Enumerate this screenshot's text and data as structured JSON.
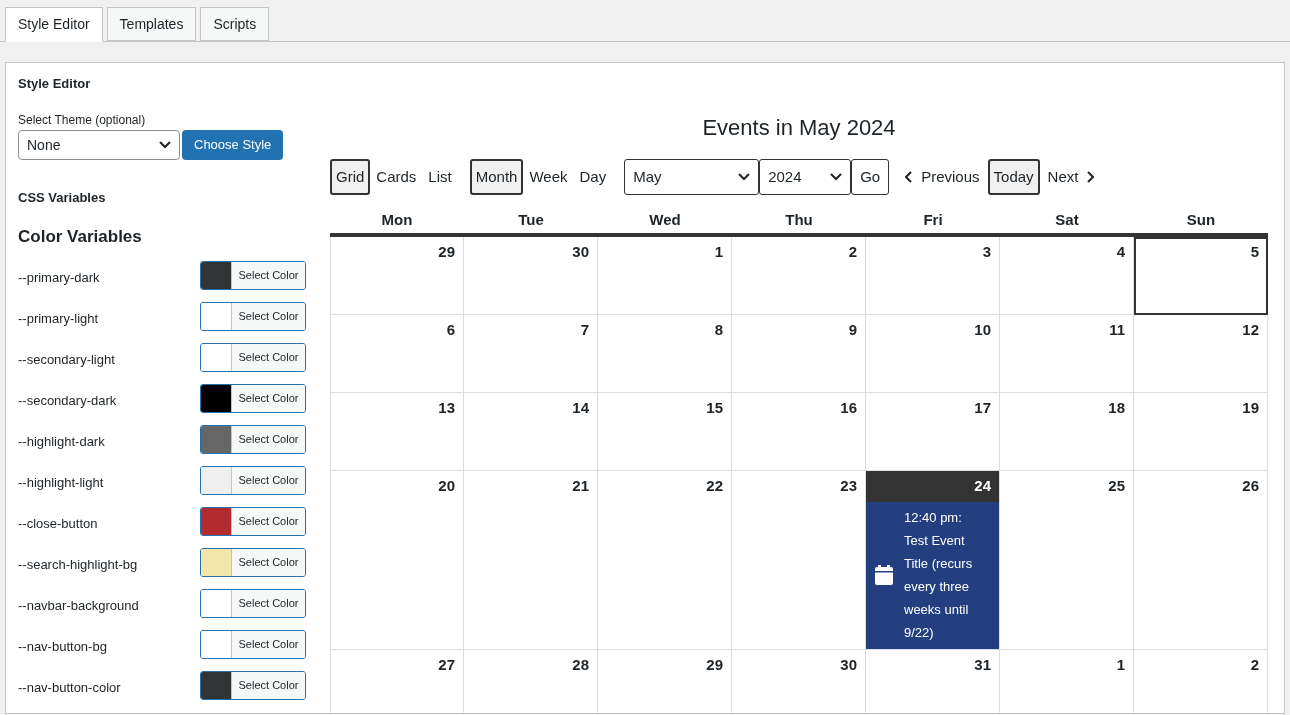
{
  "tabs": [
    {
      "label": "Style Editor",
      "selected": true
    },
    {
      "label": "Templates",
      "selected": false
    },
    {
      "label": "Scripts",
      "selected": false
    }
  ],
  "panel_title": "Style Editor",
  "theme": {
    "label": "Select Theme (optional)",
    "value": "None",
    "button": "Choose Style"
  },
  "css_heading": "CSS Variables",
  "color_heading": "Color Variables",
  "color_variables": [
    {
      "name": "--primary-dark",
      "color": "#313335",
      "button": "Select Color"
    },
    {
      "name": "--primary-light",
      "color": "#ffffff",
      "button": "Select Color"
    },
    {
      "name": "--secondary-light",
      "color": "#ffffff",
      "button": "Select Color"
    },
    {
      "name": "--secondary-dark",
      "color": "#000000",
      "button": "Select Color"
    },
    {
      "name": "--highlight-dark",
      "color": "#666666",
      "button": "Select Color"
    },
    {
      "name": "--highlight-light",
      "color": "#efefef",
      "button": "Select Color"
    },
    {
      "name": "--close-button",
      "color": "#b22c2f",
      "button": "Select Color"
    },
    {
      "name": "--search-highlight-bg",
      "color": "#f4e5ab",
      "button": "Select Color"
    },
    {
      "name": "--navbar-background",
      "color": "#ffffff",
      "button": "Select Color"
    },
    {
      "name": "--nav-button-bg",
      "color": "#ffffff",
      "button": "Select Color"
    },
    {
      "name": "--nav-button-color",
      "color": "#313335",
      "button": "Select Color"
    }
  ],
  "calendar": {
    "title": "Events in May 2024",
    "formats": [
      {
        "label": "Grid",
        "selected": true
      },
      {
        "label": "Cards",
        "selected": false
      },
      {
        "label": "List",
        "selected": false
      }
    ],
    "ranges": [
      {
        "label": "Month",
        "selected": true
      },
      {
        "label": "Week",
        "selected": false
      },
      {
        "label": "Day",
        "selected": false
      }
    ],
    "month_select": "May",
    "year_select": "2024",
    "go": "Go",
    "previous": "Previous",
    "today": "Today",
    "next": "Next",
    "weekdays": [
      "Mon",
      "Tue",
      "Wed",
      "Thu",
      "Fri",
      "Sat",
      "Sun"
    ],
    "weeks": [
      [
        {
          "day": "29",
          "today": false
        },
        {
          "day": "30",
          "today": false
        },
        {
          "day": "1",
          "today": false
        },
        {
          "day": "2",
          "today": false
        },
        {
          "day": "3",
          "today": false
        },
        {
          "day": "4",
          "today": false
        },
        {
          "day": "5",
          "today": true
        }
      ],
      [
        {
          "day": "6",
          "today": false
        },
        {
          "day": "7",
          "today": false
        },
        {
          "day": "8",
          "today": false
        },
        {
          "day": "9",
          "today": false
        },
        {
          "day": "10",
          "today": false
        },
        {
          "day": "11",
          "today": false
        },
        {
          "day": "12",
          "today": false
        }
      ],
      [
        {
          "day": "13",
          "today": false
        },
        {
          "day": "14",
          "today": false
        },
        {
          "day": "15",
          "today": false
        },
        {
          "day": "16",
          "today": false
        },
        {
          "day": "17",
          "today": false
        },
        {
          "day": "18",
          "today": false
        },
        {
          "day": "19",
          "today": false
        }
      ],
      [
        {
          "day": "20",
          "today": false
        },
        {
          "day": "21",
          "today": false
        },
        {
          "day": "22",
          "today": false
        },
        {
          "day": "23",
          "today": false
        },
        {
          "day": "24",
          "today": false,
          "events": [
            "12:40 pm: Test Event Title (recurs every three weeks until 9/22)"
          ]
        },
        {
          "day": "25",
          "today": false
        },
        {
          "day": "26",
          "today": false
        }
      ],
      [
        {
          "day": "27",
          "today": false
        },
        {
          "day": "28",
          "today": false
        },
        {
          "day": "29",
          "today": false
        },
        {
          "day": "30",
          "today": false
        },
        {
          "day": "31",
          "today": false
        },
        {
          "day": "1",
          "today": false
        },
        {
          "day": "2",
          "today": false
        }
      ]
    ]
  }
}
